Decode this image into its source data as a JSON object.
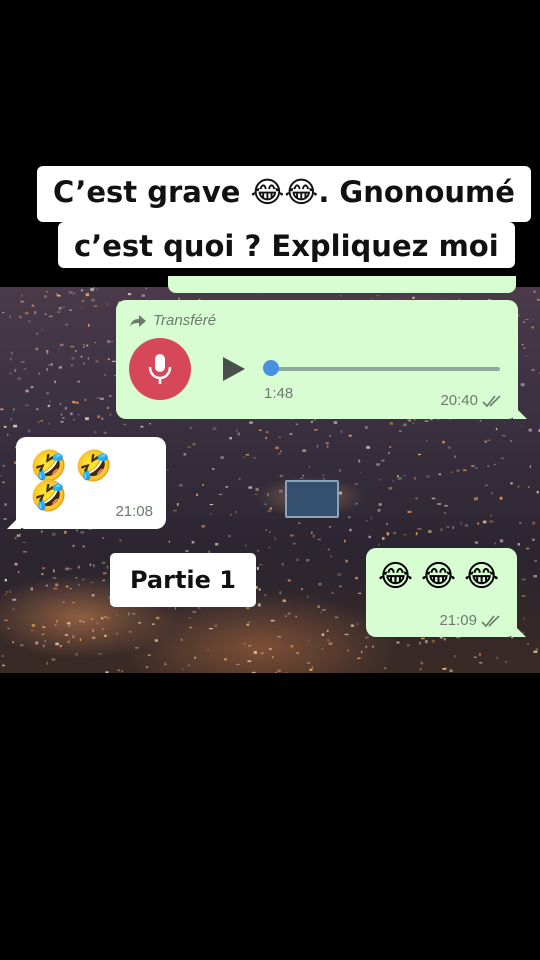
{
  "caption": {
    "line1": "C’est grave 😂😂. Gnonoumé",
    "line2": "c’est quoi ? Expliquez moi"
  },
  "messages": {
    "voice": {
      "forwarded_label": "Transféré",
      "duration": "1:48",
      "time": "20:40",
      "progress": 0,
      "icons": [
        "forward-arrow-icon",
        "microphone-icon",
        "play-icon",
        "double-check-icon"
      ]
    },
    "incoming": {
      "emojis": "🤣🤣🤣",
      "time": "21:08"
    },
    "outgoing": {
      "emojis": "😂😂😂",
      "time": "21:09"
    }
  },
  "overlay_label": "Partie 1",
  "colors": {
    "outgoing_bubble": "#d9fdd3",
    "incoming_bubble": "#ffffff",
    "mic_button": "#d6475a",
    "progress_knob": "#4a90e2"
  }
}
